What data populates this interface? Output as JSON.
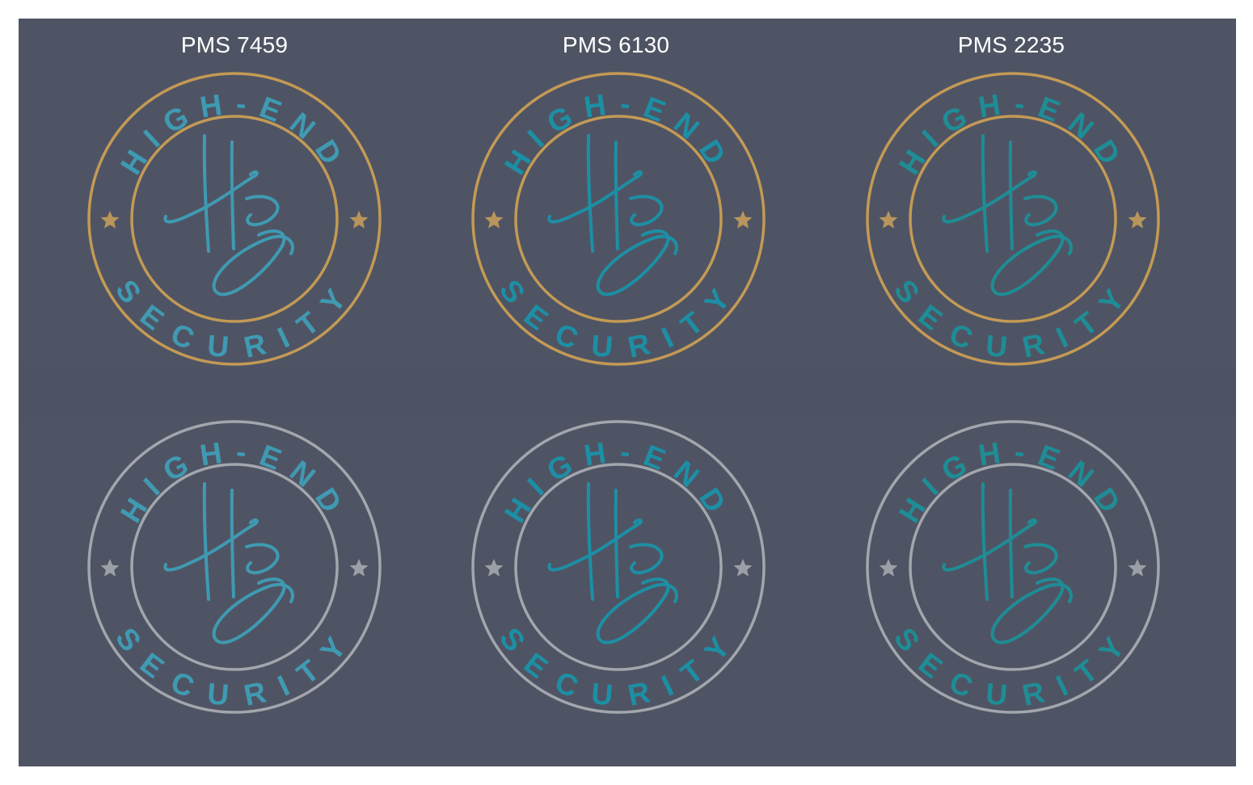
{
  "labels": [
    "PMS 7459",
    "PMS 6130",
    "PMS 2235"
  ],
  "logo": {
    "top_text": "HIGH-END",
    "bottom_text": "SECURITY",
    "monogram": "HE"
  },
  "colors": {
    "background": "#4f5464",
    "gold": "#c39a55",
    "gray": "#a3a6ad",
    "star_gold": "#b8955a",
    "star_gray": "#9c9fa6",
    "variants": [
      "#3f9ab2",
      "#1c8fa5",
      "#1e8d96"
    ]
  },
  "rows": [
    {
      "ring_color": "gold",
      "star_icon": "star-icon"
    },
    {
      "ring_color": "gray",
      "star_icon": "star-icon"
    }
  ]
}
